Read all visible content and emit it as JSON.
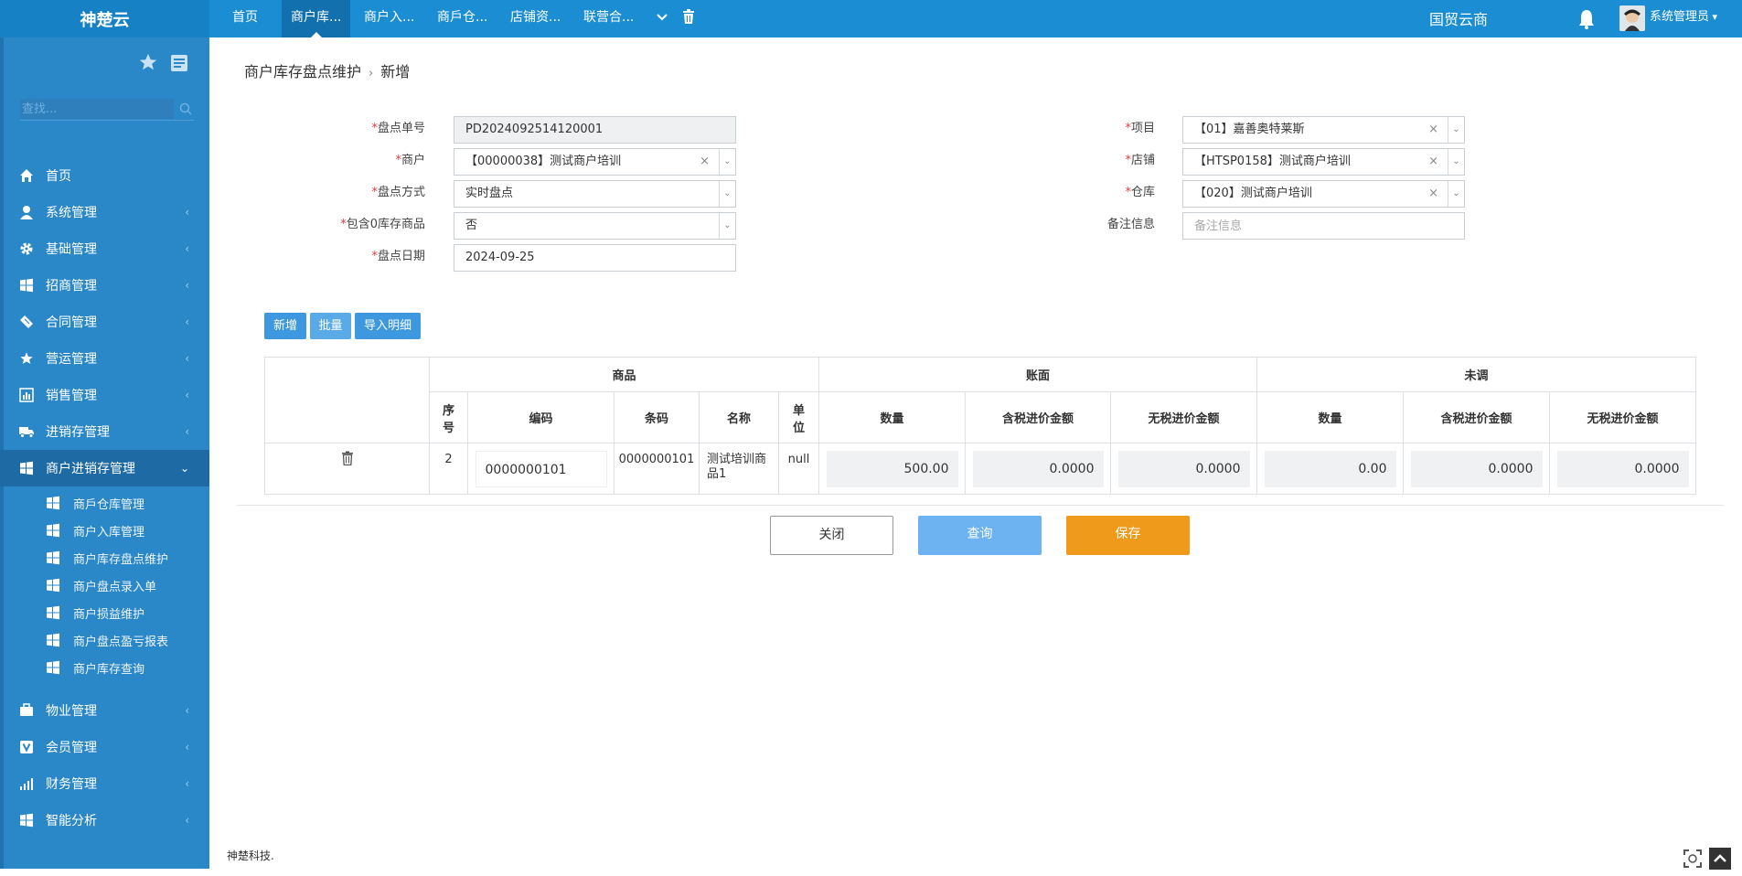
{
  "app": {
    "brand": "神楚云"
  },
  "topnav": {
    "tabs": [
      "首页",
      "商户库...",
      "商户入...",
      "商戶仓...",
      "店铺资...",
      "联营合..."
    ],
    "more_icon": "chevron-down-icon",
    "trash_icon": "trash-icon",
    "org": "国贸云商",
    "username": "系统管理员"
  },
  "sidebar": {
    "search_placeholder": "查找...",
    "menus": [
      {
        "label": "首页",
        "icon": "home-icon"
      },
      {
        "label": "系统管理",
        "icon": "user-icon"
      },
      {
        "label": "基础管理",
        "icon": "gear-icon"
      },
      {
        "label": "招商管理",
        "icon": "windows-icon"
      },
      {
        "label": "合同管理",
        "icon": "ticket-icon"
      },
      {
        "label": "营运管理",
        "icon": "star-icon"
      },
      {
        "label": "销售管理",
        "icon": "chart-icon"
      },
      {
        "label": "进销存管理",
        "icon": "truck-icon"
      },
      {
        "label": "商户进销存管理",
        "icon": "windows-icon"
      },
      {
        "label": "物业管理",
        "icon": "briefcase-icon"
      },
      {
        "label": "会员管理",
        "icon": "v-icon"
      },
      {
        "label": "财务管理",
        "icon": "signal-icon"
      },
      {
        "label": "智能分析",
        "icon": "windows-icon"
      }
    ],
    "submenu": [
      "商戶仓库管理",
      "商户入库管理",
      "商户库存盘点维护",
      "商户盘点录入单",
      "商户损益维护",
      "商户盘点盈亏报表",
      "商户库存查询"
    ]
  },
  "breadcrumb": {
    "parent": "商户库存盘点维护",
    "current": "新增"
  },
  "form": {
    "left": [
      {
        "label": "盘点单号",
        "value": "PD2024092514120001"
      },
      {
        "label": "商户",
        "value": "【00000038】测试商户培训"
      },
      {
        "label": "盘点方式",
        "value": "实时盘点"
      },
      {
        "label": "包含0库存商品",
        "value": "否"
      },
      {
        "label": "盘点日期",
        "value": "2024-09-25"
      }
    ],
    "right": [
      {
        "label": "项目",
        "value": "【01】嘉善奥特莱斯"
      },
      {
        "label": "店铺",
        "value": "【HTSP0158】测试商户培训"
      },
      {
        "label": "仓库",
        "value": "【020】测试商户培训"
      },
      {
        "label": "备注信息",
        "placeholder": "备注信息"
      }
    ],
    "clear_mark": "×",
    "required_mark": "*"
  },
  "actions": {
    "add": "新增",
    "batch": "批量",
    "import": "导入明细"
  },
  "grid": {
    "group_headers": [
      "商品",
      "账面",
      "未调"
    ],
    "columns": [
      "序号",
      "编码",
      "条码",
      "名称",
      "单位",
      "数量",
      "含税进价金额",
      "无税进价金额",
      "数量",
      "含税进价金额",
      "无税进价金额"
    ],
    "rows": [
      {
        "seq": "2",
        "code": "0000000101",
        "barcode": "0000000101",
        "name": "测试培训商品1",
        "unit": "null",
        "book_qty": "500.00",
        "book_tax_amt": "0.0000",
        "book_notax_amt": "0.0000",
        "adj_qty": "0.00",
        "adj_tax_amt": "0.0000",
        "adj_notax_amt": "0.0000"
      }
    ]
  },
  "buttons": {
    "close": "关闭",
    "query": "查询",
    "save": "保存"
  },
  "footer": "神楚科技.",
  "colors": {
    "topbar": "#1b8ed3",
    "sidebar": "#2b88c8",
    "save": "#ef9a1a",
    "query": "#6db3f2"
  }
}
